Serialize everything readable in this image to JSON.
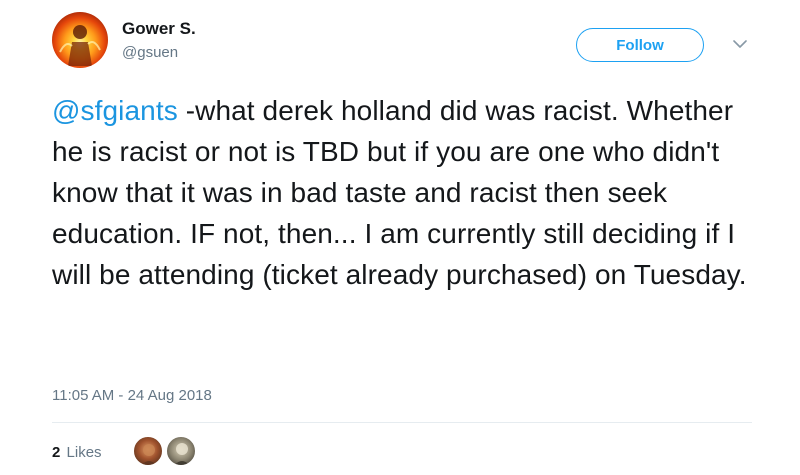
{
  "user": {
    "display_name": "Gower S.",
    "handle": "@gsuen"
  },
  "follow_button": {
    "label": "Follow"
  },
  "tweet": {
    "mention": "@sfgiants",
    "text": " -what derek holland did was racist. Whether he is racist or not is TBD but if you are one who didn't know that it was in bad taste and racist then seek education. IF not, then... I am currently still deciding if I will be attending (ticket already purchased) on Tuesday.",
    "timestamp": "11:05 AM - 24 Aug 2018"
  },
  "stats": {
    "likes_count": "2",
    "likes_label": "Likes"
  },
  "colors": {
    "accent": "#1da1f2",
    "mention": "#1b95e0",
    "secondary_text": "#657786",
    "primary_text": "#14171a"
  },
  "icons": {
    "caret": "chevron-down-icon"
  }
}
